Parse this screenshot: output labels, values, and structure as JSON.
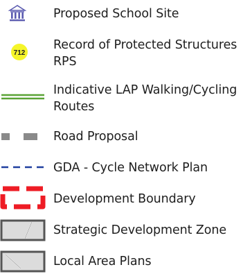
{
  "legend": {
    "items": [
      {
        "key": "school",
        "label": "Proposed School Site",
        "icon": "school-building-icon"
      },
      {
        "key": "rps",
        "label_line1": "Record of Protected Structures",
        "label_line2": "RPS",
        "marker_text": "712",
        "icon": "rps-marker-icon"
      },
      {
        "key": "walking",
        "label_line1": "Indicative LAP Walking/Cycling",
        "label_line2": "Routes",
        "icon": "double-green-line-icon"
      },
      {
        "key": "road",
        "label": "Road Proposal",
        "icon": "grey-dashed-line-icon"
      },
      {
        "key": "gda",
        "label": "GDA - Cycle Network Plan",
        "icon": "blue-dashed-line-icon"
      },
      {
        "key": "boundary",
        "label": "Development Boundary",
        "icon": "red-dashed-rectangle-icon"
      },
      {
        "key": "sdz",
        "label": "Strategic Development Zone",
        "icon": "grey-hatched-box-icon"
      },
      {
        "key": "lap",
        "label": "Local Area Plans",
        "icon": "grey-crossed-box-icon"
      }
    ]
  },
  "colors": {
    "school_icon": "#5b5bb0",
    "rps_marker": "#f5f52a",
    "walking_route": "#5aa336",
    "road": "#8a8a8a",
    "gda": "#1f3f9f",
    "boundary": "#ee1c25",
    "zone_border": "#555555",
    "zone_fill": "#dcdcdc",
    "text": "#1e1e1e"
  }
}
